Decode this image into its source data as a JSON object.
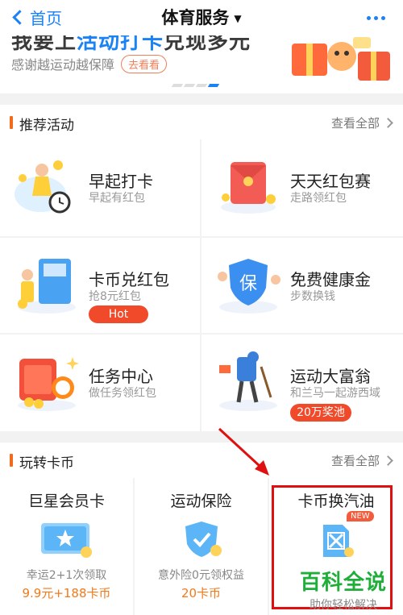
{
  "nav": {
    "back_label": "首页",
    "title": "体育服务",
    "title_caret": "▼"
  },
  "banner": {
    "headline_prefix": "我要上",
    "headline_highlight": "活动打卡",
    "headline_suffix": "兑现多元",
    "subtitle": "感谢越运动越保障",
    "button_label": "去看看",
    "page_indicator": {
      "count": 4,
      "active_index": 3
    }
  },
  "recommend": {
    "title": "推荐活动",
    "view_all": "查看全部",
    "items": [
      {
        "title": "早起打卡",
        "subtitle": "早起有红包",
        "icon": "morning-checkin-illustration"
      },
      {
        "title": "天天红包赛",
        "subtitle": "走路领红包",
        "icon": "red-envelope-illustration"
      },
      {
        "title": "卡币兑红包",
        "subtitle": "抢8元红包",
        "tag": "Hot",
        "icon": "atm-illustration"
      },
      {
        "title": "免费健康金",
        "subtitle": "步数换钱",
        "icon": "shield-bao-illustration"
      },
      {
        "title": "任务中心",
        "subtitle": "做任务领红包",
        "icon": "task-envelope-illustration"
      },
      {
        "title": "运动大富翁",
        "subtitle": "和兰马一起游西域",
        "tag": "20万奖池",
        "icon": "hiker-illustration"
      }
    ]
  },
  "coins": {
    "title": "玩转卡币",
    "view_all": "查看全部",
    "cards": [
      {
        "title": "巨星会员卡",
        "desc": "幸运2+1次领取",
        "price": "9.9元+188卡币",
        "icon": "star-card-icon"
      },
      {
        "title": "运动保险",
        "desc": "意外险0元领权益",
        "price": "20卡币",
        "icon": "shield-check-icon"
      },
      {
        "title": "卡币换汽油",
        "badge": "NEW",
        "icon": "fuel-can-icon"
      }
    ]
  },
  "watermark": {
    "title": "百科全说",
    "subtitle": "助你轻松解决"
  },
  "colors": {
    "accent_blue": "#1b82f5",
    "section_bar": "#f26b1d",
    "hot_tag": "#f04a2b",
    "price": "#f27a1a",
    "annotation_red": "#e01010",
    "watermark_green": "#1fae3a"
  }
}
